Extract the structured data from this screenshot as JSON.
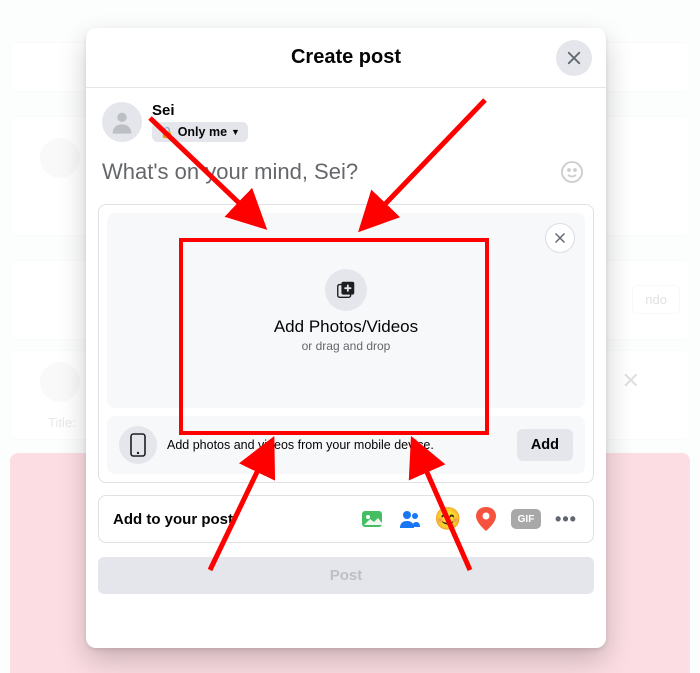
{
  "modal": {
    "title": "Create post",
    "author": {
      "name": "Sei",
      "privacy_label": "Only me"
    },
    "placeholder": "What's on your mind, Sei?",
    "upload": {
      "title": "Add Photos/Videos",
      "subtitle": "or drag and drop"
    },
    "mobile": {
      "text": "Add photos and videos from your mobile device.",
      "button": "Add"
    },
    "add_to_post_label": "Add to your post",
    "gif_label": "GIF",
    "post_button": "Post"
  },
  "background": {
    "title_input_hint": "Title:",
    "partial_button": "ndo"
  }
}
